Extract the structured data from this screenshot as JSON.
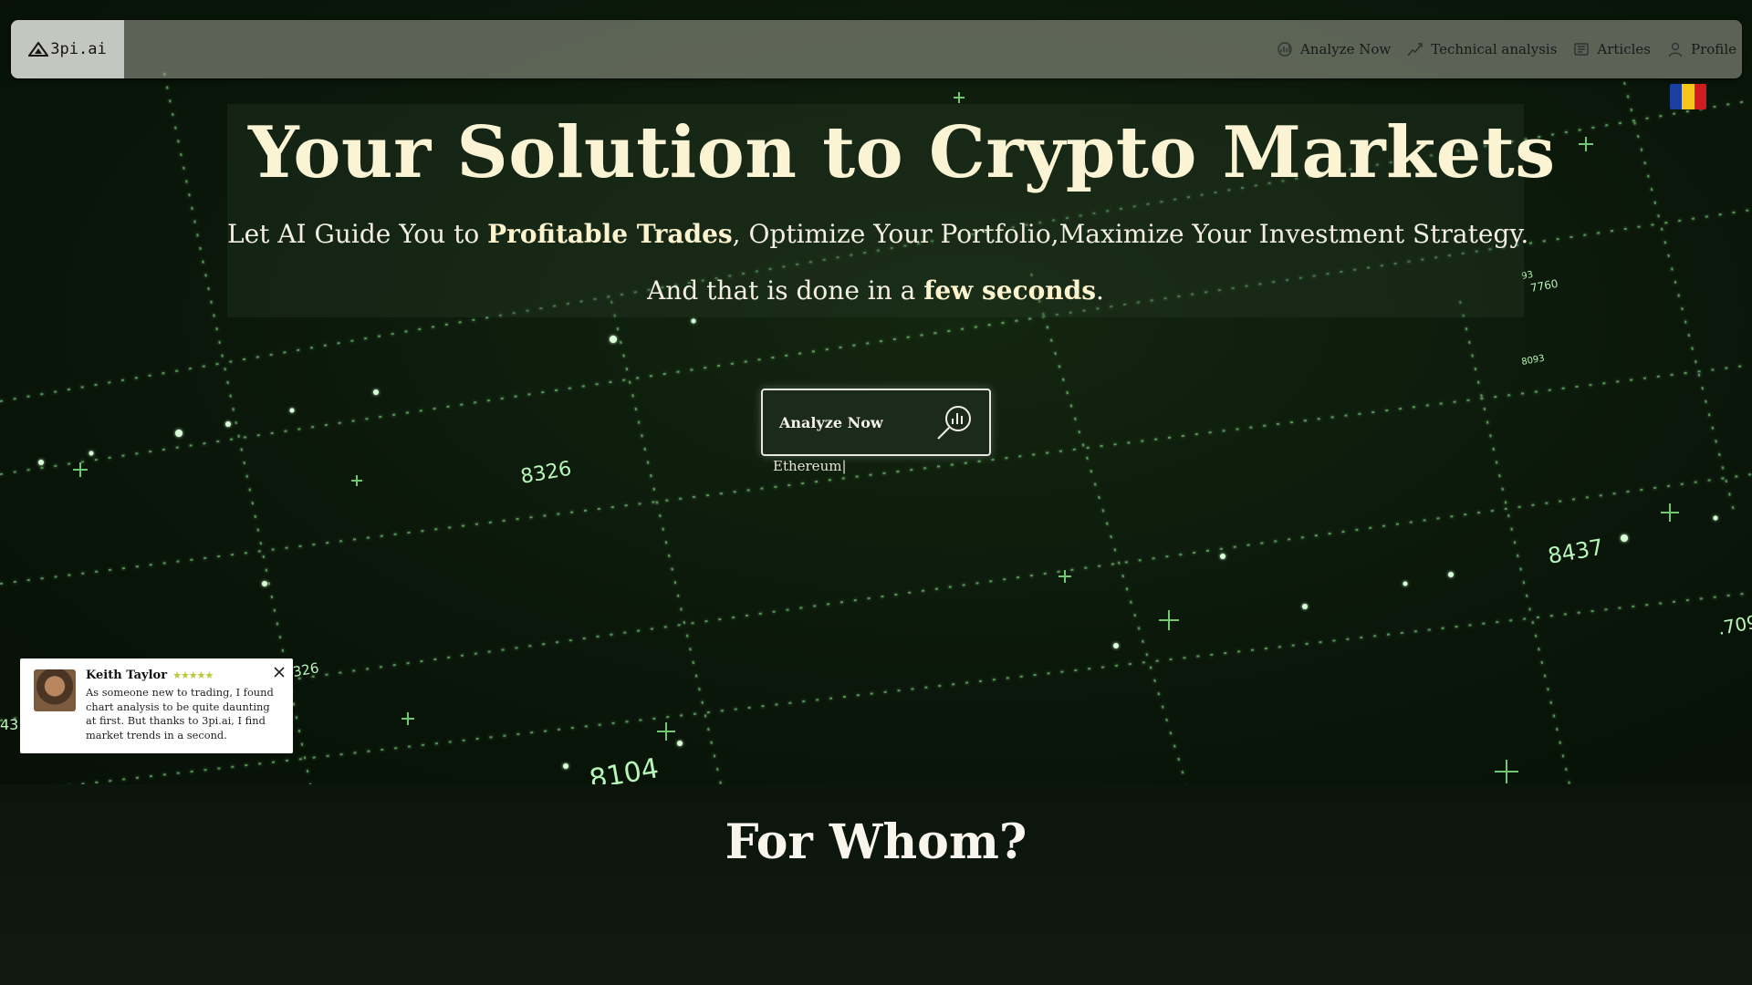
{
  "navbar": {
    "logo_text": "3pi.ai",
    "links": [
      {
        "label": "Analyze Now",
        "icon": "chart-analysis-icon"
      },
      {
        "label": "Technical analysis",
        "icon": "trend-line-icon"
      },
      {
        "label": "Articles",
        "icon": "newspaper-icon"
      },
      {
        "label": "Profile",
        "icon": "user-icon"
      }
    ],
    "language_flag": "romania-flag-icon"
  },
  "hero": {
    "title": "Your Solution to Crypto Markets",
    "subtitle_pre": "Let AI Guide You to ",
    "subtitle_bold": "Profitable Trades",
    "subtitle_post": ", Optimize Your Portfolio,Maximize Your Investment Strategy.",
    "line2_pre": "And that is done in a ",
    "line2_bold": "few seconds",
    "line2_post": "."
  },
  "cta": {
    "label": "Analyze Now",
    "icon": "magnifier-chart-icon",
    "typed_text": "Ethereum|"
  },
  "background_numbers": [
    "8326",
    "8104",
    "8437",
    "7760",
    "8093",
    "326",
    "43",
    ".709",
    "93"
  ],
  "testimonial": {
    "name": "Keith Taylor",
    "stars": "★★★★★",
    "text": "As someone new to trading, I found chart analysis to be quite daunting at first. But thanks to 3pi.ai, I find market trends in a second."
  },
  "section": {
    "heading": "For Whom?"
  },
  "colors": {
    "accent_green": "#8cf58c",
    "title_cream": "#fbf4d4",
    "flag_blue": "#1a3fa0",
    "flag_yellow": "#f5c518",
    "flag_red": "#d01c1f"
  }
}
